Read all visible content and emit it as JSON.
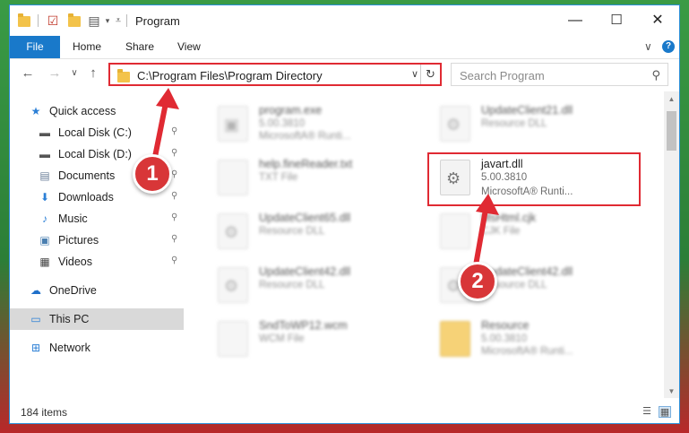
{
  "window": {
    "title": "Program",
    "menu_arrow": "▾",
    "buttons": {
      "minimize": "—",
      "maximize": "☐",
      "close": "✕"
    }
  },
  "ribbon": {
    "tabs": [
      "File",
      "Home",
      "Share",
      "View"
    ],
    "expand": "∨",
    "help": "?"
  },
  "address": {
    "back": "←",
    "forward": "→",
    "recent": "∨",
    "up": "↑",
    "path": "C:\\Program Files\\Program Directory",
    "dropdown": "∨",
    "refresh": "↻"
  },
  "search": {
    "placeholder": "Search Program",
    "icon": "⚲"
  },
  "sidebar": {
    "items": [
      {
        "label": "Quick access",
        "icon": "star-icon",
        "glyph": "★",
        "color": "#2b7fd6",
        "pinned": false
      },
      {
        "label": "Local Disk (C:)",
        "icon": "drive-icon",
        "glyph": "▬",
        "color": "#555555",
        "pinned": true
      },
      {
        "label": "Local Disk (D:)",
        "icon": "drive-icon",
        "glyph": "▬",
        "color": "#555555",
        "pinned": true
      },
      {
        "label": "Documents",
        "icon": "documents-icon",
        "glyph": "▤",
        "color": "#6b7f99",
        "pinned": true
      },
      {
        "label": "Downloads",
        "icon": "download-icon",
        "glyph": "⬇",
        "color": "#2b7fd6",
        "pinned": true
      },
      {
        "label": "Music",
        "icon": "music-icon",
        "glyph": "♪",
        "color": "#2b7fd6",
        "pinned": true
      },
      {
        "label": "Pictures",
        "icon": "pictures-icon",
        "glyph": "▣",
        "color": "#4a7fb0",
        "pinned": true
      },
      {
        "label": "Videos",
        "icon": "video-icon",
        "glyph": "▦",
        "color": "#444444",
        "pinned": true
      },
      {
        "label": "OneDrive",
        "icon": "cloud-icon",
        "glyph": "☁",
        "color": "#1e6fc9",
        "pinned": false
      },
      {
        "label": "This PC",
        "icon": "computer-icon",
        "glyph": "▭",
        "color": "#2b7fd6",
        "pinned": false
      },
      {
        "label": "Network",
        "icon": "network-icon",
        "glyph": "⊞",
        "color": "#2b7fd6",
        "pinned": false
      }
    ],
    "pin_glyph": "📌"
  },
  "files": [
    {
      "name": "program.exe",
      "line1": "5.00.3810",
      "line2": "MicrosoftA® Runti...",
      "icon": "exe-icon"
    },
    {
      "name": "UpdateClient21.dll",
      "line1": "Resource DLL",
      "line2": "",
      "icon": "dll-icon"
    },
    {
      "name": "help.fineReader.txt",
      "line1": "TXT File",
      "line2": "",
      "icon": "txt-icon"
    },
    {
      "name": "javart.dll",
      "line1": "5.00.3810",
      "line2": "MicrosoftA® Runti...",
      "icon": "dll-icon"
    },
    {
      "name": "UpdateClient65.dll",
      "line1": "Resource DLL",
      "line2": "",
      "icon": "dll-icon"
    },
    {
      "name": "MsHtml.cjk",
      "line1": "CJK File",
      "line2": "",
      "icon": "file-icon"
    },
    {
      "name": "UpdateClient42.dll",
      "line1": "Resource DLL",
      "line2": "",
      "icon": "dll-icon"
    },
    {
      "name": "UpdateClient42.dll",
      "line1": "Resource DLL",
      "line2": "",
      "icon": "dll-icon"
    },
    {
      "name": "SndToWP12.wcm",
      "line1": "WCM File",
      "line2": "",
      "icon": "file-icon"
    },
    {
      "name": "Resource",
      "line1": "5.00.3810",
      "line2": "MicrosoftA® Runti...",
      "icon": "folder-icon"
    }
  ],
  "status": {
    "items_count": "184 items"
  },
  "annotations": {
    "badge1": "1",
    "badge2": "2"
  },
  "colors": {
    "accent": "#1979ca",
    "highlight": "#e02a33",
    "badge": "#d83638"
  }
}
